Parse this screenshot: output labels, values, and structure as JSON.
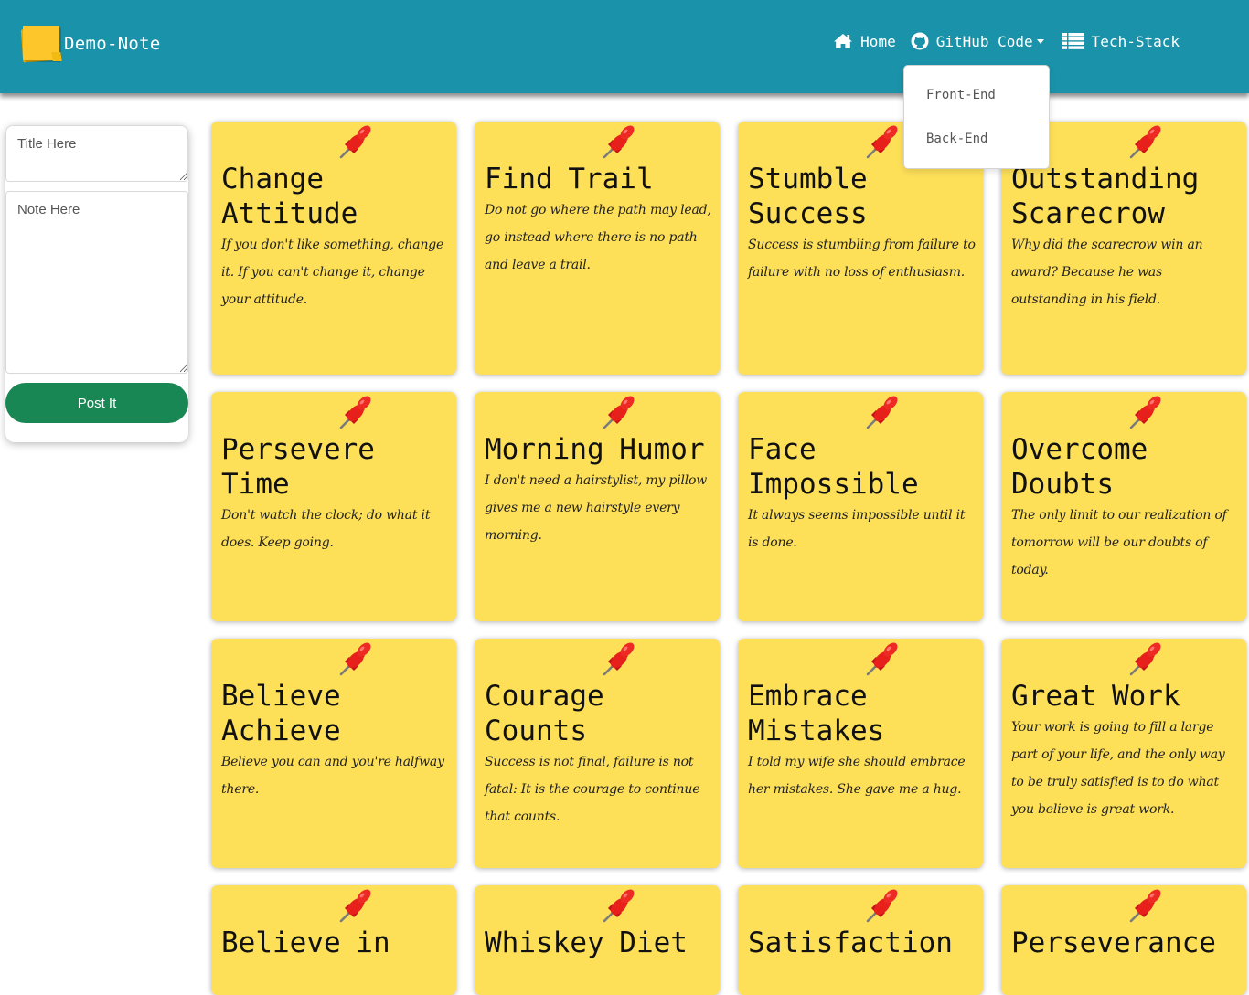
{
  "navbar": {
    "brand": "Demo-Note",
    "links": [
      {
        "label": "Home",
        "icon": "home-icon"
      },
      {
        "label": "GitHub Code",
        "icon": "github-icon"
      },
      {
        "label": "Tech-Stack",
        "icon": "list-icon"
      }
    ],
    "dropdown": [
      "Front-End",
      "Back-End"
    ]
  },
  "form": {
    "title_placeholder": "Title Here",
    "note_placeholder": "Note Here",
    "post_label": "Post It"
  },
  "notes": [
    {
      "title": "Change Attitude",
      "body": "If you don't like something, change it. If you can't change it, change your attitude."
    },
    {
      "title": "Find Trail",
      "body": "Do not go where the path may lead, go instead where there is no path and leave a trail."
    },
    {
      "title": "Stumble Success",
      "body": "Success is stumbling from failure to failure with no loss of enthusiasm."
    },
    {
      "title": "Outstanding Scarecrow",
      "body": "Why did the scarecrow win an award? Because he was outstanding in his field."
    },
    {
      "title": "Persevere Time",
      "body": "Don't watch the clock; do what it does. Keep going."
    },
    {
      "title": "Morning Humor",
      "body": "I don't need a hairstylist, my pillow gives me a new hairstyle every morning."
    },
    {
      "title": "Face Impossible",
      "body": "It always seems impossible until it is done."
    },
    {
      "title": "Overcome Doubts",
      "body": "The only limit to our realization of tomorrow will be our doubts of today."
    },
    {
      "title": "Believe Achieve",
      "body": "Believe you can and you're halfway there."
    },
    {
      "title": "Courage Counts",
      "body": "Success is not final, failure is not fatal: It is the courage to continue that counts."
    },
    {
      "title": "Embrace Mistakes",
      "body": "I told my wife she should embrace her mistakes. She gave me a hug."
    },
    {
      "title": "Great Work",
      "body": "Your work is going to fill a large part of your life, and the only way to be truly satisfied is to do what you believe is great work."
    },
    {
      "title": "Believe in",
      "body": ""
    },
    {
      "title": "Whiskey Diet",
      "body": ""
    },
    {
      "title": "Satisfaction",
      "body": ""
    },
    {
      "title": "Perseverance",
      "body": ""
    }
  ],
  "colors": {
    "navbar": "#1a93aa",
    "note": "#fee058",
    "post_button": "#198754",
    "pin": "#e8201c"
  }
}
